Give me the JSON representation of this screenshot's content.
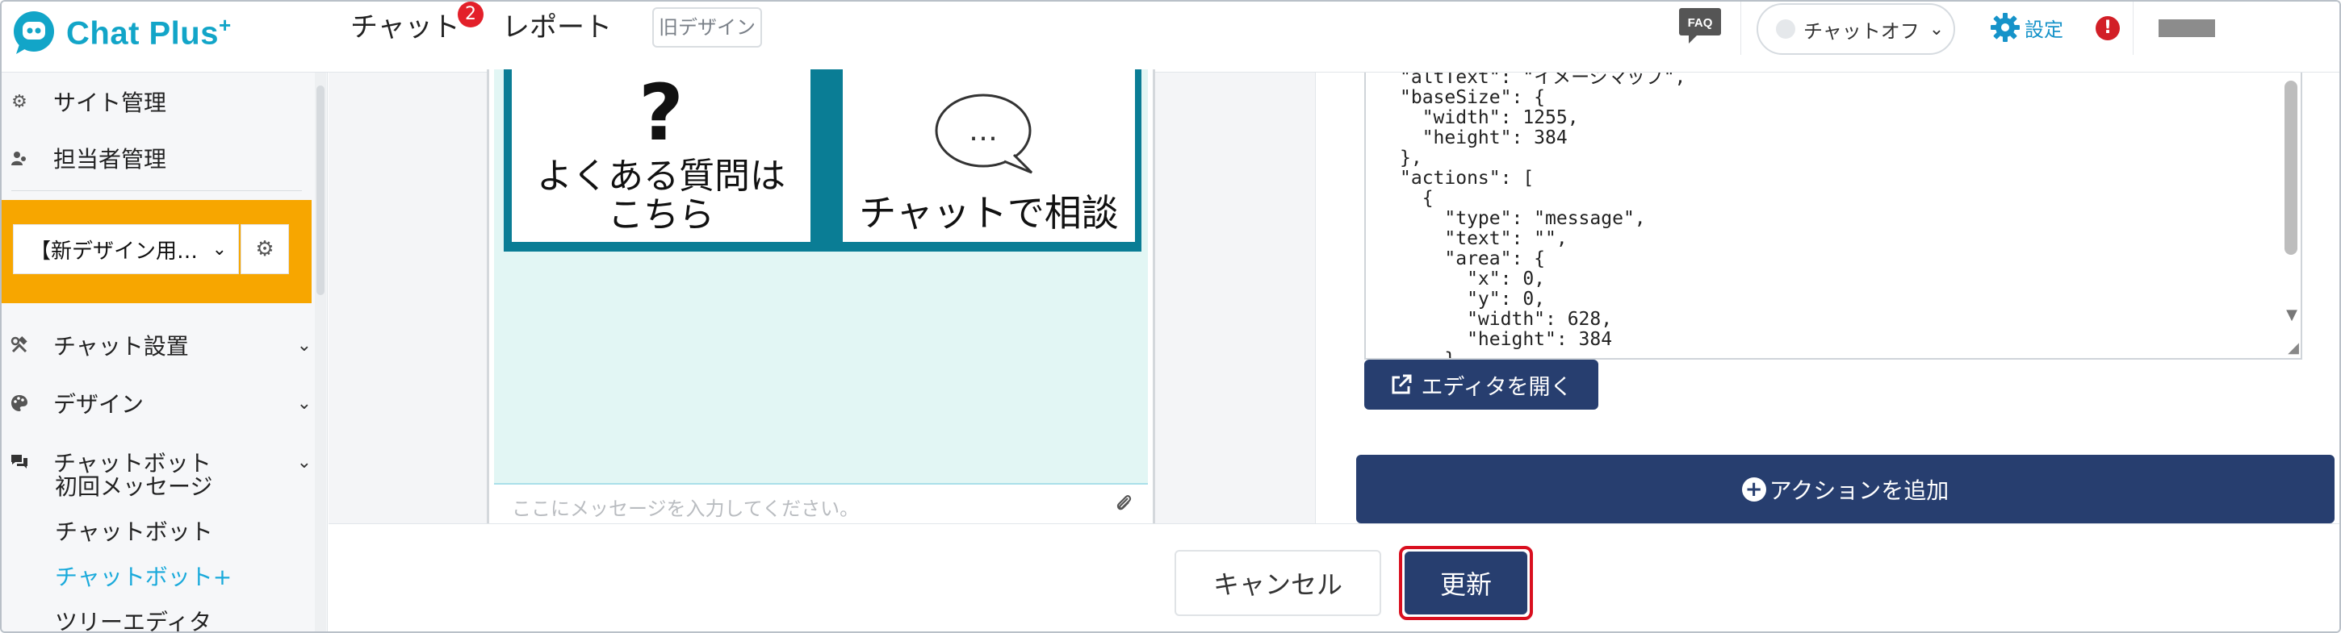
{
  "brand": {
    "name": "Chat Plus",
    "sup": "+",
    "color": "#12a5c8"
  },
  "header": {
    "nav": [
      {
        "label": "チャット",
        "badge": "2"
      },
      {
        "label": "レポート"
      }
    ],
    "old_design": "旧デザイン",
    "faq": "FAQ",
    "chat_status": "チャットオフ",
    "settings": "設定",
    "alert": "!"
  },
  "sidebar": {
    "items": [
      {
        "label": "サイト管理",
        "icon": "gear-icon"
      },
      {
        "label": "担当者管理",
        "icon": "users-icon"
      }
    ],
    "site_select": "【新デザイン用…",
    "sections": [
      {
        "label": "チャット設置",
        "icon": "tools-icon"
      },
      {
        "label": "デザイン",
        "icon": "palette-icon"
      },
      {
        "label": "チャットボット",
        "icon": "chat-bubbles-icon"
      }
    ],
    "subitems": [
      "初回メッセージ",
      "チャットボット",
      "チャットボット+",
      "ツリーエディタ"
    ],
    "accent": "#f7a600",
    "active_color": "#1aaadb"
  },
  "preview": {
    "faq_lines": [
      "よくある質問は",
      "こちら"
    ],
    "question_mark": "?",
    "bubble_text": "…",
    "consult": "チャットで相談",
    "input_placeholder": "ここにメッセージを入力してください。"
  },
  "editor": {
    "json_lines": [
      "\"altText\": \"イメージマップ\",",
      "\"baseSize\": {",
      "  \"width\": 1255,",
      "  \"height\": 384",
      "},",
      "\"actions\": [",
      "  {",
      "    \"type\": \"message\",",
      "    \"text\": \"\",",
      "    \"area\": {",
      "      \"x\": 0,",
      "      \"y\": 0,",
      "      \"width\": 628,",
      "      \"height\": 384",
      "    }"
    ],
    "open_editor": "エディタを開く",
    "add_action": "アクションを追加",
    "button_color": "#273e6f"
  },
  "footer": {
    "cancel": "キャンセル",
    "update": "更新",
    "highlight_color": "#d90f1f"
  }
}
